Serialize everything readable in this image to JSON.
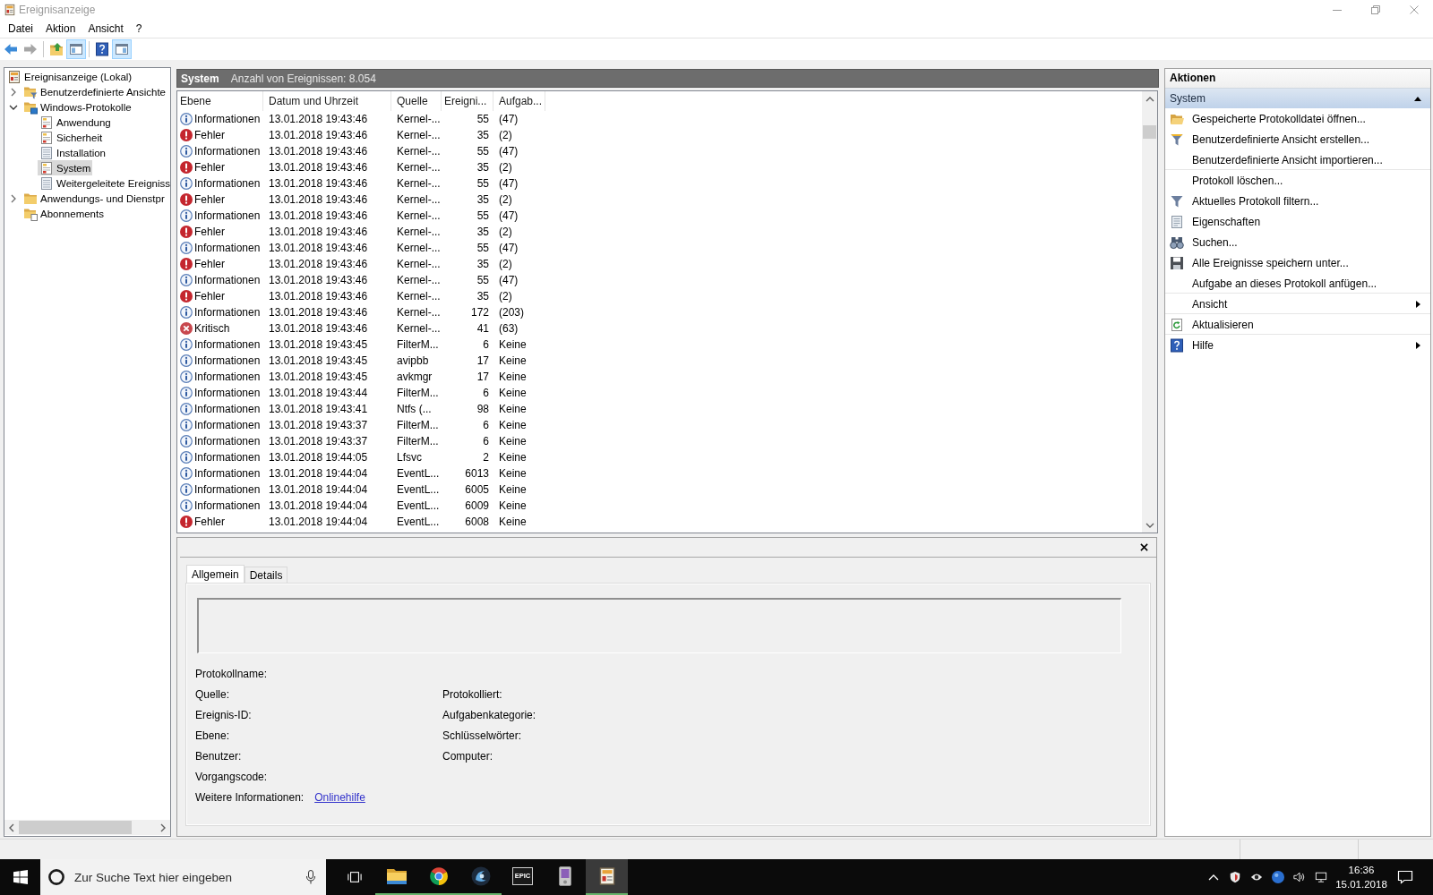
{
  "window": {
    "title": "Ereignisanzeige"
  },
  "menu": [
    "Datei",
    "Aktion",
    "Ansicht",
    "?"
  ],
  "toolbar": [
    [
      {
        "kind": "back",
        "disabled": false,
        "pressed": false
      },
      {
        "kind": "forward",
        "disabled": true,
        "pressed": false
      }
    ],
    [
      {
        "kind": "folder-up",
        "disabled": false,
        "pressed": false
      },
      {
        "kind": "tree-pane",
        "disabled": false,
        "pressed": true
      }
    ],
    [
      {
        "kind": "help",
        "disabled": false,
        "pressed": false
      },
      {
        "kind": "action-pane",
        "disabled": false,
        "pressed": true
      }
    ]
  ],
  "tree": [
    {
      "label": "Ereignisanzeige (Lokal)",
      "kind": "viewer",
      "selected": false,
      "children": [
        {
          "label": "Benutzerdefinierte Ansichte",
          "kind": "filter-folder",
          "expanded": false,
          "selected": false
        },
        {
          "label": "Windows-Protokolle",
          "kind": "windows-folder",
          "expanded": true,
          "selected": false,
          "children": [
            {
              "label": "Anwendung",
              "kind": "log",
              "selected": false
            },
            {
              "label": "Sicherheit",
              "kind": "log",
              "selected": false
            },
            {
              "label": "Installation",
              "kind": "plain-log",
              "selected": false
            },
            {
              "label": "System",
              "kind": "log",
              "selected": true
            },
            {
              "label": "Weitergeleitete Ereigniss",
              "kind": "plain-log",
              "selected": false
            }
          ]
        },
        {
          "label": "Anwendungs- und Dienstpr",
          "kind": "folder",
          "expanded": false,
          "selected": false
        },
        {
          "label": "Abonnements",
          "kind": "share-folder",
          "selected": false
        }
      ]
    }
  ],
  "events": {
    "title": "System",
    "count": "Anzahl von Ereignissen: 8.054",
    "columns": [
      "Ebene",
      "Datum und Uhrzeit",
      "Quelle",
      "Ereigni...",
      "Aufgab..."
    ],
    "rows": [
      {
        "kind": "info",
        "severity": "Informationen",
        "date": "13.01.2018 19:43:46",
        "source": "Kernel-...",
        "event_id": "55",
        "task": "(47)"
      },
      {
        "kind": "error",
        "severity": "Fehler",
        "date": "13.01.2018 19:43:46",
        "source": "Kernel-...",
        "event_id": "35",
        "task": "(2)"
      },
      {
        "kind": "info",
        "severity": "Informationen",
        "date": "13.01.2018 19:43:46",
        "source": "Kernel-...",
        "event_id": "55",
        "task": "(47)"
      },
      {
        "kind": "error",
        "severity": "Fehler",
        "date": "13.01.2018 19:43:46",
        "source": "Kernel-...",
        "event_id": "35",
        "task": "(2)"
      },
      {
        "kind": "info",
        "severity": "Informationen",
        "date": "13.01.2018 19:43:46",
        "source": "Kernel-...",
        "event_id": "55",
        "task": "(47)"
      },
      {
        "kind": "error",
        "severity": "Fehler",
        "date": "13.01.2018 19:43:46",
        "source": "Kernel-...",
        "event_id": "35",
        "task": "(2)"
      },
      {
        "kind": "info",
        "severity": "Informationen",
        "date": "13.01.2018 19:43:46",
        "source": "Kernel-...",
        "event_id": "55",
        "task": "(47)"
      },
      {
        "kind": "error",
        "severity": "Fehler",
        "date": "13.01.2018 19:43:46",
        "source": "Kernel-...",
        "event_id": "35",
        "task": "(2)"
      },
      {
        "kind": "info",
        "severity": "Informationen",
        "date": "13.01.2018 19:43:46",
        "source": "Kernel-...",
        "event_id": "55",
        "task": "(47)"
      },
      {
        "kind": "error",
        "severity": "Fehler",
        "date": "13.01.2018 19:43:46",
        "source": "Kernel-...",
        "event_id": "35",
        "task": "(2)"
      },
      {
        "kind": "info",
        "severity": "Informationen",
        "date": "13.01.2018 19:43:46",
        "source": "Kernel-...",
        "event_id": "55",
        "task": "(47)"
      },
      {
        "kind": "error",
        "severity": "Fehler",
        "date": "13.01.2018 19:43:46",
        "source": "Kernel-...",
        "event_id": "35",
        "task": "(2)"
      },
      {
        "kind": "info",
        "severity": "Informationen",
        "date": "13.01.2018 19:43:46",
        "source": "Kernel-...",
        "event_id": "172",
        "task": "(203)"
      },
      {
        "kind": "critical",
        "severity": "Kritisch",
        "date": "13.01.2018 19:43:46",
        "source": "Kernel-...",
        "event_id": "41",
        "task": "(63)"
      },
      {
        "kind": "info",
        "severity": "Informationen",
        "date": "13.01.2018 19:43:45",
        "source": "FilterM...",
        "event_id": "6",
        "task": "Keine"
      },
      {
        "kind": "info",
        "severity": "Informationen",
        "date": "13.01.2018 19:43:45",
        "source": "avipbb",
        "event_id": "17",
        "task": "Keine"
      },
      {
        "kind": "info",
        "severity": "Informationen",
        "date": "13.01.2018 19:43:45",
        "source": "avkmgr",
        "event_id": "17",
        "task": "Keine"
      },
      {
        "kind": "info",
        "severity": "Informationen",
        "date": "13.01.2018 19:43:44",
        "source": "FilterM...",
        "event_id": "6",
        "task": "Keine"
      },
      {
        "kind": "info",
        "severity": "Informationen",
        "date": "13.01.2018 19:43:41",
        "source": "Ntfs (...",
        "event_id": "98",
        "task": "Keine"
      },
      {
        "kind": "info",
        "severity": "Informationen",
        "date": "13.01.2018 19:43:37",
        "source": "FilterM...",
        "event_id": "6",
        "task": "Keine"
      },
      {
        "kind": "info",
        "severity": "Informationen",
        "date": "13.01.2018 19:43:37",
        "source": "FilterM...",
        "event_id": "6",
        "task": "Keine"
      },
      {
        "kind": "info",
        "severity": "Informationen",
        "date": "13.01.2018 19:44:05",
        "source": "Lfsvc",
        "event_id": "2",
        "task": "Keine"
      },
      {
        "kind": "info",
        "severity": "Informationen",
        "date": "13.01.2018 19:44:04",
        "source": "EventL...",
        "event_id": "6013",
        "task": "Keine"
      },
      {
        "kind": "info",
        "severity": "Informationen",
        "date": "13.01.2018 19:44:04",
        "source": "EventL...",
        "event_id": "6005",
        "task": "Keine"
      },
      {
        "kind": "info",
        "severity": "Informationen",
        "date": "13.01.2018 19:44:04",
        "source": "EventL...",
        "event_id": "6009",
        "task": "Keine"
      },
      {
        "kind": "error",
        "severity": "Fehler",
        "date": "13.01.2018 19:44:04",
        "source": "EventL...",
        "event_id": "6008",
        "task": "Keine"
      }
    ]
  },
  "details": {
    "tabs": [
      {
        "label": "Allgemein",
        "selected": true
      },
      {
        "label": "Details",
        "selected": false
      }
    ],
    "rows": [
      [
        "Protokollname:"
      ],
      [
        "Quelle:",
        "Protokolliert:"
      ],
      [
        "Ereignis-ID:",
        "Aufgabenkategorie:"
      ],
      [
        "Ebene:",
        "Schlüsselwörter:"
      ],
      [
        "Benutzer:",
        "Computer:"
      ],
      [
        "Vorgangscode:"
      ]
    ],
    "more_info": {
      "label": "Weitere Informationen:",
      "link": "Onlinehilfe"
    }
  },
  "actions": {
    "title": "Aktionen",
    "section": {
      "title": "System",
      "expanded": true,
      "groups": [
        [
          {
            "label": "Gespeicherte Protokolldatei öffnen...",
            "kind": "open-folder",
            "submenu": false
          },
          {
            "label": "Benutzerdefinierte Ansicht erstellen...",
            "kind": "filter-add",
            "submenu": false
          },
          {
            "label": "Benutzerdefinierte Ansicht importieren...",
            "kind": "none",
            "submenu": false
          }
        ],
        [
          {
            "label": "Protokoll löschen...",
            "kind": "none",
            "submenu": false
          },
          {
            "label": "Aktuelles Protokoll filtern...",
            "kind": "filter",
            "submenu": false
          },
          {
            "label": "Eigenschaften",
            "kind": "properties",
            "submenu": false
          },
          {
            "label": "Suchen...",
            "kind": "find",
            "submenu": false
          },
          {
            "label": "Alle Ereignisse speichern unter...",
            "kind": "save",
            "submenu": false
          },
          {
            "label": "Aufgabe an dieses Protokoll anfügen...",
            "kind": "none",
            "submenu": false
          }
        ],
        [
          {
            "label": "Ansicht",
            "kind": "none",
            "submenu": true
          }
        ],
        [
          {
            "label": "Aktualisieren",
            "kind": "refresh",
            "submenu": false
          }
        ],
        [
          {
            "label": "Hilfe",
            "kind": "help",
            "submenu": true
          }
        ]
      ]
    }
  },
  "taskbar": {
    "search": {
      "placeholder": "Zur Suche Text hier eingeben"
    },
    "apps": [
      {
        "kind": "explorer",
        "running": true,
        "active": false
      },
      {
        "kind": "browser",
        "running": true,
        "active": false
      },
      {
        "kind": "orb",
        "running": true,
        "active": false
      },
      {
        "kind": "epic",
        "label": "EPIC",
        "running": false,
        "active": false
      },
      {
        "kind": "device",
        "running": false,
        "active": false
      },
      {
        "kind": "viewer",
        "running": true,
        "active": true
      }
    ],
    "clock": {
      "time": "16:36",
      "date": "15.01.2018"
    }
  }
}
